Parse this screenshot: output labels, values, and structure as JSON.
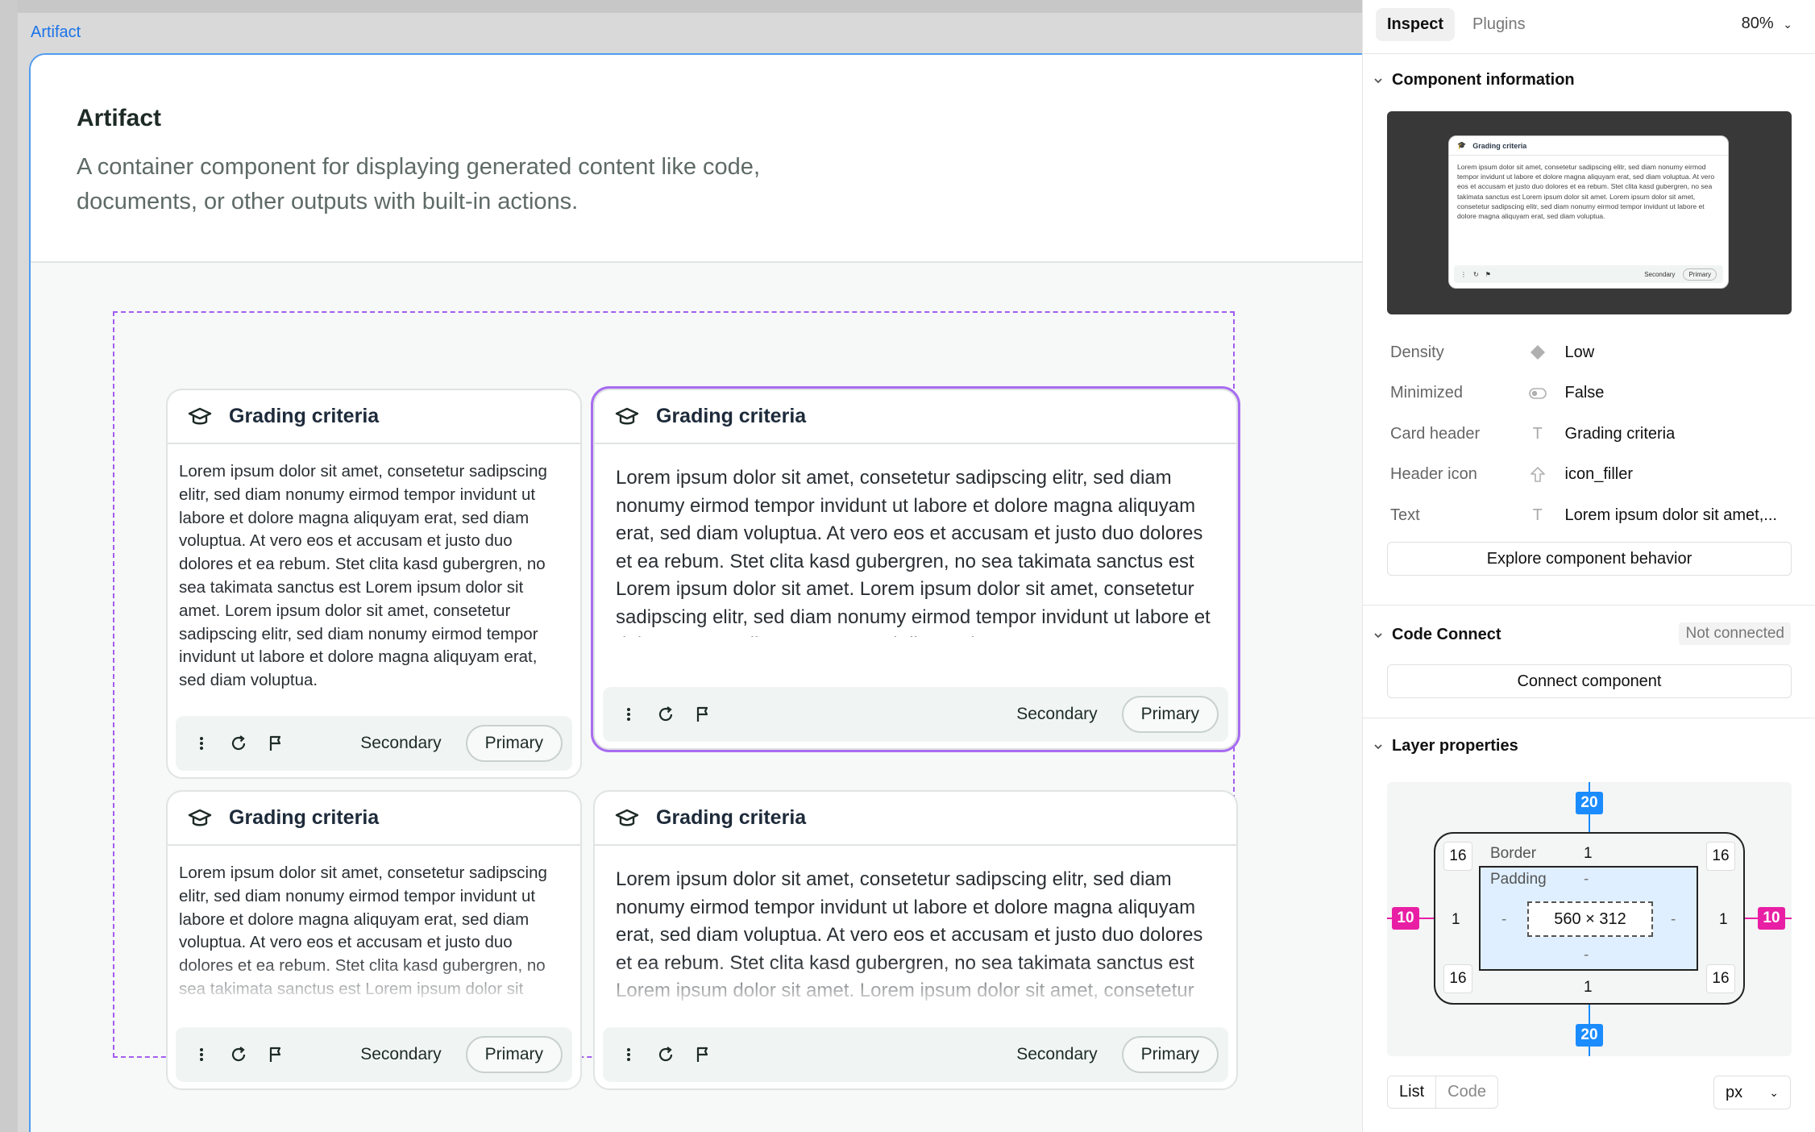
{
  "canvas": {
    "frame_label": "Artifact",
    "doc_title": "Artifact",
    "doc_description": "A container component for displaying generated content like code, documents, or other outputs with built-in actions."
  },
  "cards": [
    {
      "title": "Grading criteria",
      "text": "Lorem ipsum dolor sit amet, consetetur sadipscing elitr, sed diam nonumy eirmod tempor invidunt ut labore et dolore magna aliquyam erat, sed diam voluptua. At vero eos et accusam et justo duo dolores et ea rebum. Stet clita kasd gubergren, no sea takimata sanctus est Lorem ipsum dolor sit amet. Lorem ipsum dolor sit amet, consetetur sadipscing elitr, sed diam nonumy eirmod tempor invidunt ut labore et dolore magna aliquyam erat, sed diam voluptua.",
      "secondary": "Secondary",
      "primary": "Primary"
    },
    {
      "title": "Grading criteria",
      "text": "Lorem ipsum dolor sit amet, consetetur sadipscing elitr, sed diam nonumy eirmod tempor invidunt ut labore et dolore magna aliquyam erat, sed diam voluptua. At vero eos et accusam et justo duo dolores et ea rebum. Stet clita kasd gubergren, no sea takimata sanctus est Lorem ipsum dolor sit amet. Lorem ipsum dolor sit amet, consetetur sadipscing elitr, sed diam nonumy eirmod tempor invidunt ut labore et dolore magna aliquyam erat, sed diam voluptua.",
      "secondary": "Secondary",
      "primary": "Primary"
    },
    {
      "title": "Grading criteria",
      "text": "Lorem ipsum dolor sit amet, consetetur sadipscing elitr, sed diam nonumy eirmod tempor invidunt ut labore et dolore magna aliquyam erat, sed diam voluptua. At vero eos et accusam et justo duo dolores et ea rebum. Stet clita kasd gubergren, no sea takimata sanctus est Lorem ipsum dolor sit amet. Lorem ipsum dolor sit amet, consetetur",
      "secondary": "Secondary",
      "primary": "Primary"
    },
    {
      "title": "Grading criteria",
      "text": "Lorem ipsum dolor sit amet, consetetur sadipscing elitr, sed diam nonumy eirmod tempor invidunt ut labore et dolore magna aliquyam erat, sed diam voluptua. At vero eos et accusam et justo duo dolores et ea rebum. Stet clita kasd gubergren, no sea takimata sanctus est Lorem ipsum dolor sit amet. Lorem ipsum dolor sit amet, consetetur sadipscing elitr, sed diam nonumy eirmod tempor invidunt ut labore",
      "secondary": "Secondary",
      "primary": "Primary"
    }
  ],
  "panel": {
    "tabs": [
      "Inspect",
      "Plugins"
    ],
    "zoom": "80%",
    "component_info_title": "Component information",
    "thumb": {
      "title": "Grading criteria",
      "text": "Lorem ipsum dolor sit amet, consetetur sadipscing elitr, sed diam nonumy eirmod tempor invidunt ut labore et dolore magna aliquyam erat, sed diam voluptua. At vero eos et accusam et justo duo dolores et ea rebum. Stet clita kasd gubergren, no sea takimata sanctus est Lorem ipsum dolor sit amet. Lorem ipsum dolor sit amet, consetetur sadipscing elitr, sed diam nonumy eirmod tempor invidunt ut labore et dolore magna aliquyam erat, sed diam voluptua.",
      "secondary": "Secondary",
      "primary": "Primary"
    },
    "properties": [
      {
        "key": "Density",
        "icon": "diamond-icon",
        "value": "Low"
      },
      {
        "key": "Minimized",
        "icon": "toggle-icon",
        "value": "False"
      },
      {
        "key": "Card header",
        "icon": "text-icon",
        "value": "Grading criteria"
      },
      {
        "key": "Header icon",
        "icon": "swap-icon",
        "value": "icon_filler"
      },
      {
        "key": "Text",
        "icon": "text-icon",
        "value": "Lorem ipsum dolor sit amet,..."
      }
    ],
    "explore_button": "Explore component behavior",
    "code_connect_title": "Code Connect",
    "code_connect_status": "Not connected",
    "connect_button": "Connect component",
    "layer_props_title": "Layer properties",
    "box_model": {
      "margin_top": "20",
      "margin_bottom": "20",
      "margin_left": "10",
      "margin_right": "10",
      "border_label": "Border",
      "border_top": "1",
      "border_bottom": "1",
      "border_left": "1",
      "border_right": "1",
      "radius_tl": "16",
      "radius_tr": "16",
      "radius_bl": "16",
      "radius_br": "16",
      "padding_label": "Padding",
      "padding_top": "-",
      "padding_bottom": "-",
      "padding_left": "-",
      "padding_right": "-",
      "size": "560 × 312"
    },
    "bottom_tabs": [
      "List",
      "Code"
    ],
    "unit": "px"
  },
  "colors": {
    "selection": "#a25ef0",
    "frame_border": "#4f9cf0",
    "margin_tag": "#1a8cff",
    "side_tag": "#e81fa5",
    "action_bar": "#f0f5f3"
  }
}
